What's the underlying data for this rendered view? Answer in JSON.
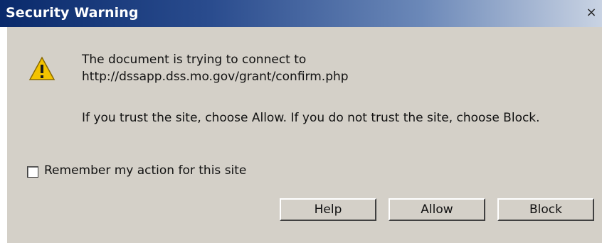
{
  "window": {
    "title": "Security Warning",
    "close_glyph": "×"
  },
  "message": {
    "line1": "The document is trying to connect to",
    "line2": "http://dssapp.dss.mo.gov/grant/confirm.php",
    "line3": "If you trust the site, choose Allow. If you do not trust the site, choose Block."
  },
  "remember": {
    "label": "Remember my action for this site",
    "checked": false
  },
  "buttons": {
    "help": "Help",
    "allow": "Allow",
    "block": "Block"
  },
  "icons": {
    "warning": "warning-icon"
  },
  "colors": {
    "title_start": "#0a2a6b",
    "title_end": "#c9d3e3",
    "dialog_bg": "#d4d0c8",
    "warning_fill": "#f3c300"
  }
}
